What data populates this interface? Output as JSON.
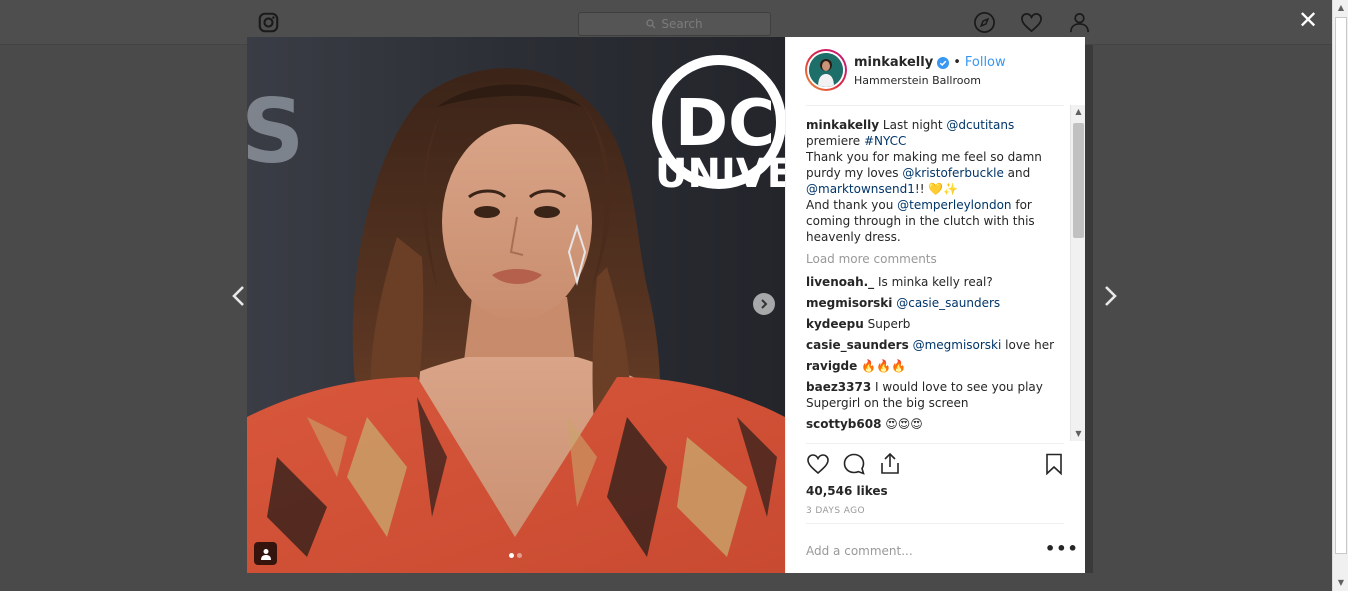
{
  "background": {
    "search_placeholder": "Search"
  },
  "post": {
    "username": "minkakelly",
    "follow_label": "Follow",
    "location": "Hammerstein Ballroom",
    "caption": {
      "user": "minkakelly",
      "part1": "Last night ",
      "mention1": "@dcutitans",
      "part2": " premiere ",
      "hashtag": "#NYCC",
      "part3": "Thank you for making me feel so damn purdy my loves ",
      "mention2": "@kristoferbuckle",
      "part4": " and ",
      "mention3": "@marktownsend1",
      "part5": "!! 💛✨",
      "part6": "And thank you ",
      "mention4": "@temperleylondon",
      "part7": " for coming through in the clutch with this heavenly dress."
    },
    "load_more": "Load more comments",
    "comments": [
      {
        "user": "livenoah._",
        "text": "Is minka kelly real?",
        "mention": ""
      },
      {
        "user": "megmisorski",
        "text": "",
        "mention": "@casie_saunders"
      },
      {
        "user": "kydeepu",
        "text": "Superb",
        "mention": ""
      },
      {
        "user": "casie_saunders",
        "text": " love her",
        "mention": "@megmisorski"
      },
      {
        "user": "ravigde",
        "text": "🔥🔥🔥",
        "mention": ""
      },
      {
        "user": "baez3373",
        "text": "I would love to see you play Supergirl on the big screen",
        "mention": ""
      },
      {
        "user": "scottyb608",
        "text": "😍😍😍",
        "mention": ""
      }
    ],
    "likes": "40,546 likes",
    "timestamp": "3 DAYS AGO",
    "add_comment_placeholder": "Add a comment...",
    "more_options": "•••",
    "photo_text": {
      "logo": "DC",
      "brand": "UNIVERS"
    }
  },
  "ui": {
    "close": "✕"
  }
}
